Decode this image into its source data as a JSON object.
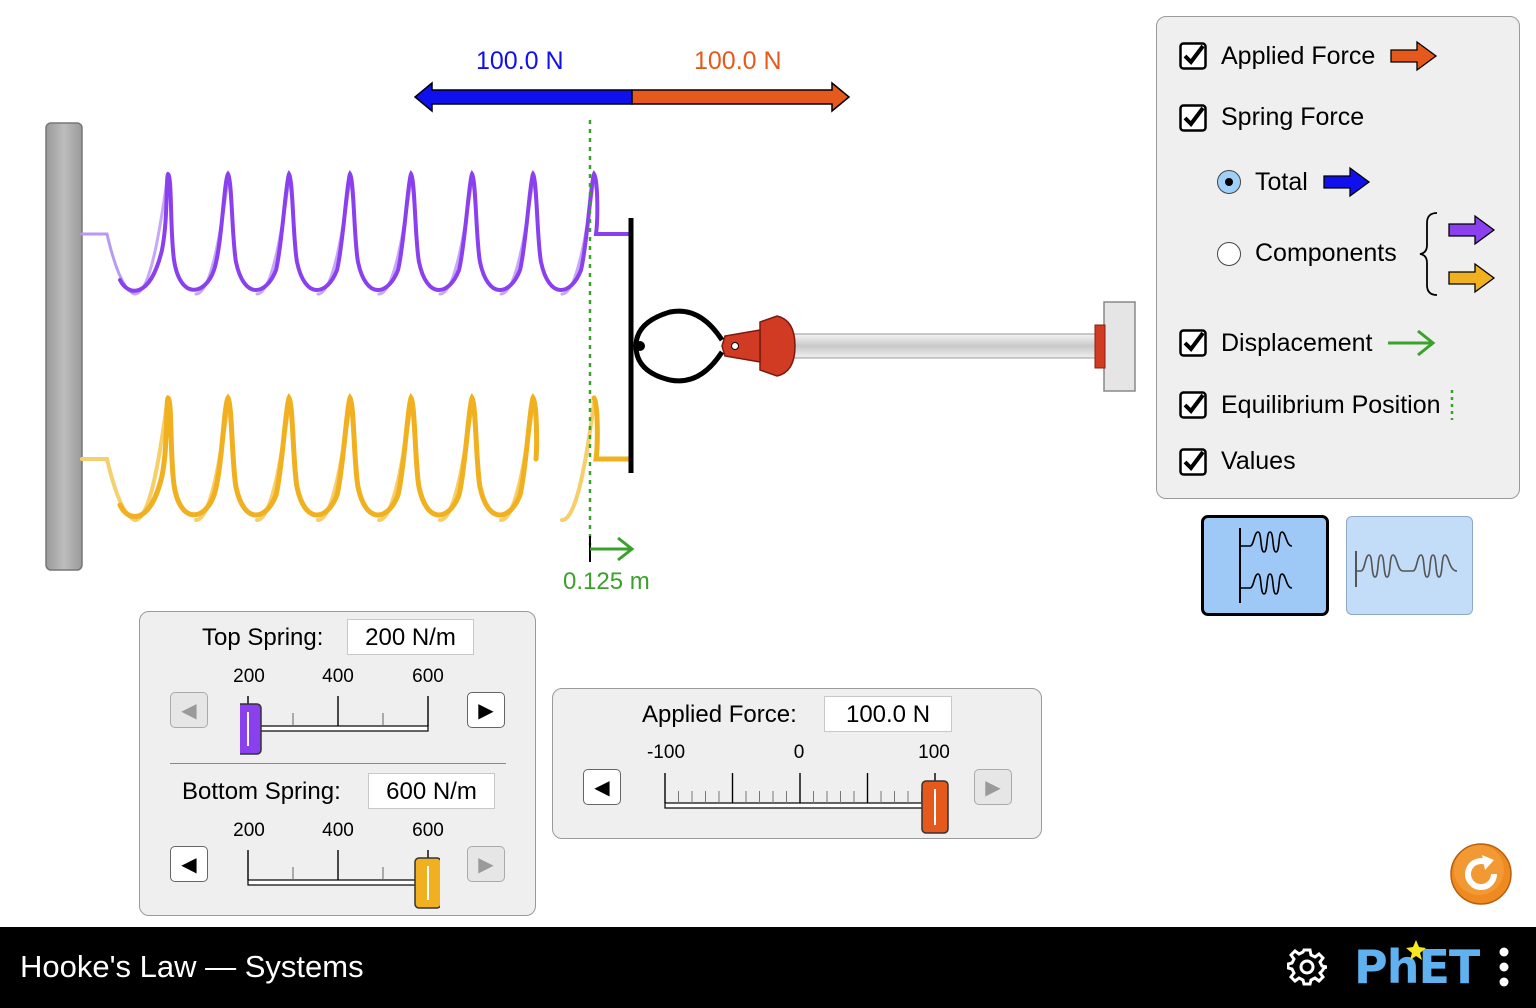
{
  "app": {
    "title": "Hooke's Law — Systems"
  },
  "colors": {
    "applied": "#e55a1c",
    "total": "#1010ee",
    "top_spring": "#8a40ee",
    "bottom_spring": "#f0b020",
    "displacement": "#3aa22a",
    "scene_selected": "#9ec9f7",
    "scene_unselected": "#c3dcf8",
    "reset": "#ef8a20"
  },
  "force_readouts": {
    "total_spring_force": "100.0 N",
    "applied_force": "100.0 N"
  },
  "displacement": {
    "label": "0.125 m"
  },
  "controls": {
    "applied_force": {
      "checked": true,
      "label": "Applied Force"
    },
    "spring_force": {
      "checked": true,
      "label": "Spring Force"
    },
    "total": {
      "selected": true,
      "label": "Total"
    },
    "components": {
      "selected": false,
      "label": "Components"
    },
    "displacement": {
      "checked": true,
      "label": "Displacement"
    },
    "equilibrium": {
      "checked": true,
      "label": "Equilibrium Position"
    },
    "values": {
      "checked": true,
      "label": "Values"
    }
  },
  "scene_buttons": {
    "parallel": {
      "selected": true
    },
    "series": {
      "selected": false
    }
  },
  "top_spring": {
    "label": "Top Spring:",
    "value_text": "200 N/m",
    "value": 200,
    "min": 100,
    "max": 600,
    "ticks": [
      "200",
      "400",
      "600"
    ]
  },
  "bottom_spring": {
    "label": "Bottom Spring:",
    "value_text": "600 N/m",
    "value": 600,
    "min": 100,
    "max": 600,
    "ticks": [
      "200",
      "400",
      "600"
    ]
  },
  "applied_force_slider": {
    "label": "Applied Force:",
    "value_text": "100.0 N",
    "value": 100,
    "min": -100,
    "max": 100,
    "ticks": [
      "-100",
      "0",
      "100"
    ]
  },
  "icons": {
    "settings": "gear-icon",
    "reset": "reset-icon",
    "menu": "kebab-menu-icon",
    "logo": "phet-logo"
  },
  "logo_text": "PhET"
}
